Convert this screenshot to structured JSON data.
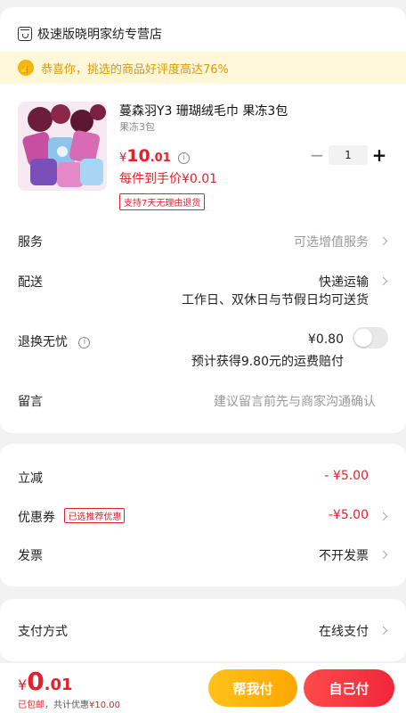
{
  "store": {
    "name": "极速版晓明家纺专营店"
  },
  "praise_banner": {
    "text": "恭喜你，挑选的商品好评度高达76%"
  },
  "product": {
    "title": "蔓森羽Y3 珊瑚绒毛巾 果冻3包",
    "spec": "果冻3包",
    "price_yen": "¥",
    "price_int": "10",
    "price_dec": ".01",
    "unit_price": "每件到手价¥0.01",
    "return_badge": "支持7天无理由退货",
    "quantity": "1"
  },
  "rows": {
    "service": {
      "label": "服务",
      "value": "可选增值服务"
    },
    "delivery": {
      "label": "配送",
      "value": "快递运输",
      "note": "工作日、双休日与节假日均可送货"
    },
    "worry_free": {
      "label": "退换无忧",
      "price": "¥0.80",
      "note": "预计获得9.80元的运费赔付"
    },
    "message": {
      "label": "留言",
      "placeholder": "建议留言前先与商家沟通确认"
    }
  },
  "price_summary": {
    "discount": {
      "label": "立减",
      "value": "- ¥5.00"
    },
    "coupon": {
      "label": "优惠券",
      "tag": "已选推荐优惠",
      "value": "-¥5.00"
    },
    "invoice": {
      "label": "发票",
      "value": "不开发票"
    }
  },
  "payment": {
    "label": "支付方式",
    "value": "在线支付"
  },
  "bottom": {
    "yen": "¥",
    "int": "0",
    "dec": ".01",
    "shipping": "已包邮",
    "saved_prefix": "，共计优惠",
    "saved": "¥10.00",
    "help_button": "帮我付",
    "self_button": "自己付"
  },
  "colors": {
    "accent": "#e4202e",
    "banner": "#fff7d9",
    "banner_text": "#d99a00",
    "help_btn": "#ffb300",
    "self_btn": "#f0263a"
  }
}
